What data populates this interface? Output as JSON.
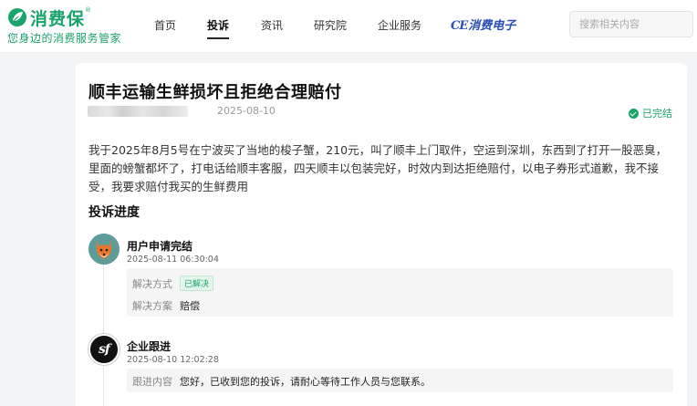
{
  "brand": {
    "name": "消费保",
    "reg": "®",
    "slogan": "您身边的消费服务管家",
    "accent": "#1aa36a"
  },
  "nav": {
    "items": [
      {
        "label": "首页"
      },
      {
        "label": "投诉",
        "active": true
      },
      {
        "label": "资讯"
      },
      {
        "label": "研究院"
      },
      {
        "label": "企业服务"
      }
    ],
    "brand_link": {
      "prefix": "CE",
      "label": "消费电子"
    }
  },
  "search": {
    "placeholder": "搜索相关内容",
    "value": ""
  },
  "complaint": {
    "title": "顺丰运输生鲜损坏且拒绝合理赔付",
    "date": "2025-08-10",
    "status": "已完结",
    "description": "我于2025年8月5号在宁波买了当地的梭子蟹，210元，叫了顺丰上门取件，空运到深圳，东西到了打开一股恶臭，里面的螃蟹都坏了，打电话给顺丰客服，四天顺丰以包装完好，时效内到达拒绝赔付，以电子券形式道歉，我不接受，我要求赔付我买的生鲜费用"
  },
  "progress": {
    "section_title": "投诉进度",
    "events": [
      {
        "avatar_icon": "fox-avatar-icon",
        "title": "用户申请完结",
        "time": "2025-08-11 06:30:04",
        "rows": [
          {
            "label": "解决方式",
            "tag": "已解决"
          },
          {
            "label": "解决方案",
            "value": "赔偿"
          }
        ]
      },
      {
        "avatar_icon": "sf-logo-icon",
        "avatar_text": "sf",
        "title": "企业跟进",
        "time": "2025-08-10 12:02:28",
        "rows": [
          {
            "label": "跟进内容",
            "value": "您好，已收到您的投诉，请耐心等待工作人员与您联系。"
          }
        ]
      }
    ]
  }
}
